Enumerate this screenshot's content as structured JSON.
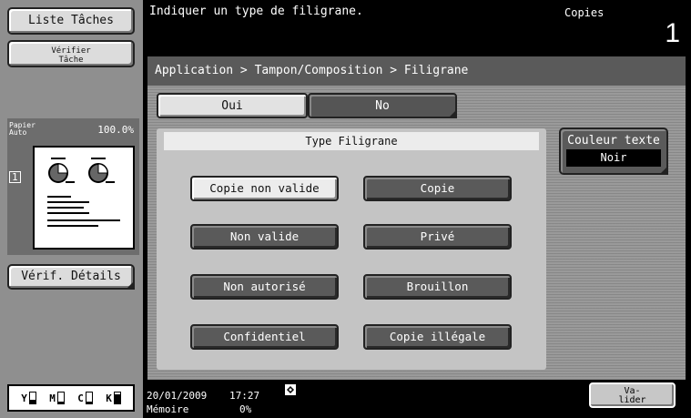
{
  "left": {
    "liste_taches": "Liste Tâches",
    "verifier_tache": "Vérifier\nTâche",
    "paper_label": "Papier\nAuto",
    "zoom": "100.0%",
    "page_number": "1",
    "verif_details": "Vérif. Détails",
    "inks": [
      {
        "letter": "Y",
        "level": 0.35
      },
      {
        "letter": "M",
        "level": 0.2
      },
      {
        "letter": "C",
        "level": 0.2
      },
      {
        "letter": "K",
        "level": 0.85
      }
    ]
  },
  "header": {
    "instruction": "Indiquer un type de filigrane.",
    "copies_label": "Copies",
    "copies_count": "1"
  },
  "breadcrumb": "Application > Tampon/Composition > Filigrane",
  "toggle": {
    "oui": "Oui",
    "no": "No"
  },
  "type_filigrane": {
    "title": "Type Filigrane",
    "options": [
      "Copie non valide",
      "Copie",
      "Non valide",
      "Privé",
      "Non autorisé",
      "Brouillon",
      "Confidentiel",
      "Copie illégale"
    ]
  },
  "couleur": {
    "label": "Couleur texte",
    "value": "Noir"
  },
  "status": {
    "date": "20/01/2009",
    "time": "17:27",
    "memory_label": "Mémoire",
    "memory_value": "0%",
    "valider": "Va-\nlider"
  }
}
